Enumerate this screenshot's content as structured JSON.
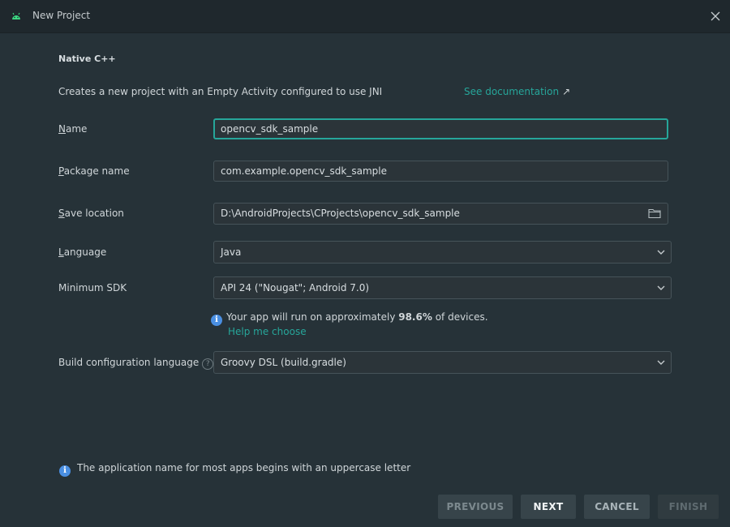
{
  "window": {
    "title": "New Project",
    "app_icon": "android-icon",
    "close_icon": "close-icon"
  },
  "header": {
    "section_title": "Native C++",
    "description": "Creates a new project with an Empty Activity configured to use JNI",
    "doc_link": "See documentation",
    "doc_link_icon": "external-link-arrow-icon"
  },
  "form": {
    "name": {
      "label_prefix": "N",
      "label_rest": "ame",
      "value": "opencv_sdk_sample"
    },
    "package": {
      "label_prefix": "P",
      "label_rest": "ackage name",
      "value": "com.example.opencv_sdk_sample"
    },
    "save_location": {
      "label_prefix": "S",
      "label_rest": "ave location",
      "value": "D:\\AndroidProjects\\CProjects\\opencv_sdk_sample",
      "icon": "folder-icon"
    },
    "language": {
      "label_prefix": "L",
      "label_rest": "anguage",
      "value": "Java"
    },
    "min_sdk": {
      "label": "Minimum SDK",
      "value": "API 24 (\"Nougat\"; Android 7.0)"
    },
    "sdk_info": {
      "prefix": "Your app will run on approximately ",
      "percent": "98.6%",
      "suffix": " of devices.",
      "help_link": "Help me choose"
    },
    "build_config": {
      "label": "Build configuration language",
      "value": "Groovy DSL (build.gradle)"
    }
  },
  "footer": {
    "info": "The application name for most apps begins with an uppercase letter",
    "buttons": {
      "previous": "PREVIOUS",
      "next": "NEXT",
      "cancel": "CANCEL",
      "finish": "FINISH"
    }
  },
  "colors": {
    "background": "#263238",
    "accent": "#26a69a",
    "info": "#4a8fe2"
  }
}
